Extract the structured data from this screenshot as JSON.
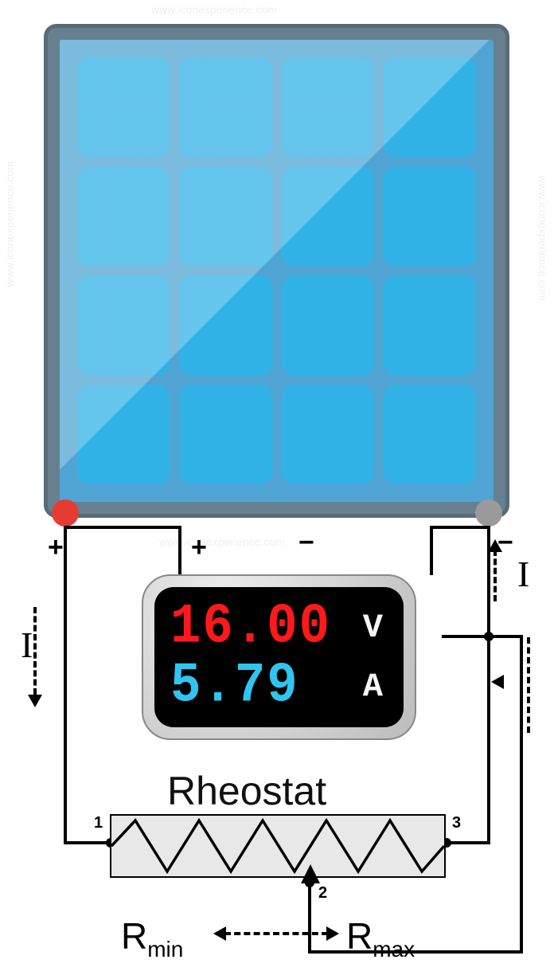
{
  "panel": {
    "positive": "+",
    "negative": "−"
  },
  "meter": {
    "voltage_value": "16.00",
    "voltage_unit": "V",
    "current_value": "5.79",
    "current_unit": "A",
    "pos": "+",
    "neg": "−"
  },
  "rheostat": {
    "label": "Rheostat",
    "node1": "1",
    "node2": "2",
    "node3": "3",
    "r_letter": "R",
    "min": "min",
    "max": "max"
  },
  "current_label": "I",
  "watermark": "www.iconexperience.com"
}
